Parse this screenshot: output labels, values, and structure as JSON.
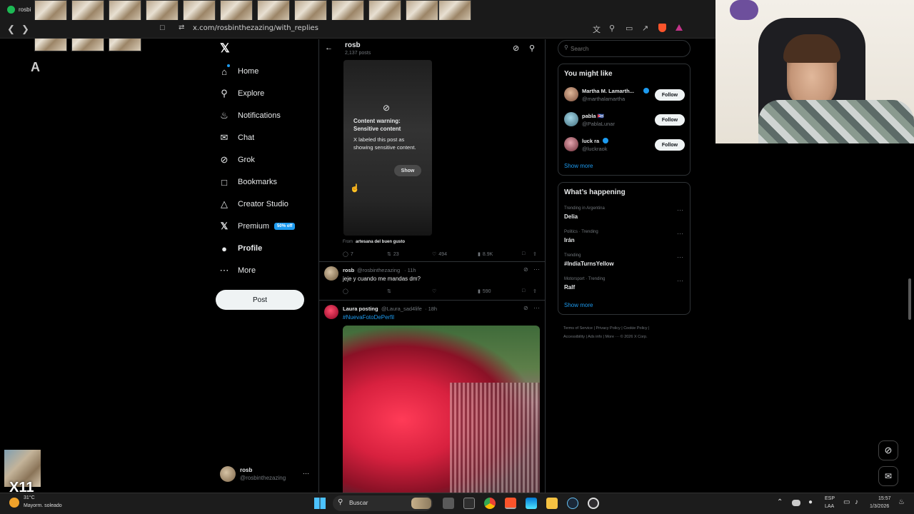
{
  "browser": {
    "tab_title": "rosbi",
    "url": "x.com/rosbinthezazing/with_replies"
  },
  "nav": {
    "items": [
      {
        "label": "Home",
        "icon": "home-icon"
      },
      {
        "label": "Explore",
        "icon": "search-icon"
      },
      {
        "label": "Notifications",
        "icon": "bell-icon"
      },
      {
        "label": "Chat",
        "icon": "chat-icon"
      },
      {
        "label": "Grok",
        "icon": "grok-icon"
      },
      {
        "label": "Bookmarks",
        "icon": "bookmark-icon"
      },
      {
        "label": "Creator Studio",
        "icon": "creator-icon"
      },
      {
        "label": "Premium",
        "icon": "x-icon"
      },
      {
        "label": "Profile",
        "icon": "person-icon"
      },
      {
        "label": "More",
        "icon": "more-icon"
      }
    ],
    "premium_badge": "50% off",
    "post_label": "Post",
    "account_name": "rosb",
    "account_handle": "@rosbinthezazing",
    "account_more": "···"
  },
  "header": {
    "title": "rosb",
    "subtitle": "2,137 posts"
  },
  "sensitive": {
    "title": "Content warning: Sensitive content",
    "body": "X labeled this post as showing sensitive content.",
    "show_label": "Show",
    "from_prefix": "From",
    "from_name": "artesana del buen gusto",
    "replies": "7",
    "reposts": "23",
    "likes": "494",
    "views": "8.9K"
  },
  "tweet_reply": {
    "name": "rosb",
    "handle": "@rosbinthezazing",
    "time": "· 11h",
    "text": "jeje y cuando me mandas dm?",
    "views": "590"
  },
  "tweet_laura": {
    "name": "Laura posting",
    "handle": "@Laura_sad4life",
    "time": "· 18h",
    "hashtag": "#NuevaFotoDePerfil"
  },
  "search": {
    "placeholder": "Search"
  },
  "you_might_like": {
    "title": "You might like",
    "accounts": [
      {
        "name": "Martha M. Lamarth...",
        "handle": "@marthalamartha",
        "button": "Follow"
      },
      {
        "name": "pabla 🇨🇺",
        "handle": "@PablaLunar",
        "button": "Follow"
      },
      {
        "name": "luck ra",
        "handle": "@luckraok",
        "button": "Follow"
      }
    ],
    "show_more": "Show more"
  },
  "whats_happening": {
    "title": "What’s happening",
    "trends": [
      {
        "context": "Trending in Argentina",
        "name": "Delia"
      },
      {
        "context": "Politics · Trending",
        "name": "Irán"
      },
      {
        "context": "Trending",
        "name": "#IndiaTurnsYellow"
      },
      {
        "context": "Motorsport · Trending",
        "name": "Ralf"
      }
    ],
    "show_more": "Show more"
  },
  "footer": {
    "line1": [
      "Terms of Service",
      "Privacy Policy",
      "Cookie Policy"
    ],
    "line2": [
      "Accessibility",
      "Ads info",
      "More ···",
      "© 2026 X Corp."
    ]
  },
  "weather": {
    "temp": "31°C",
    "desc": "Mayorm. soleado"
  },
  "taskbar": {
    "search_label": "Buscar",
    "lang": "ESP",
    "lang2": "LAA",
    "time": "15:57",
    "date": "1/3/2026"
  },
  "overlay_text": {
    "a_glyph": "A",
    "x11": "X11"
  },
  "colors": {
    "accent": "#1d9bf0",
    "background": "#000000",
    "border": "#2f3336"
  }
}
